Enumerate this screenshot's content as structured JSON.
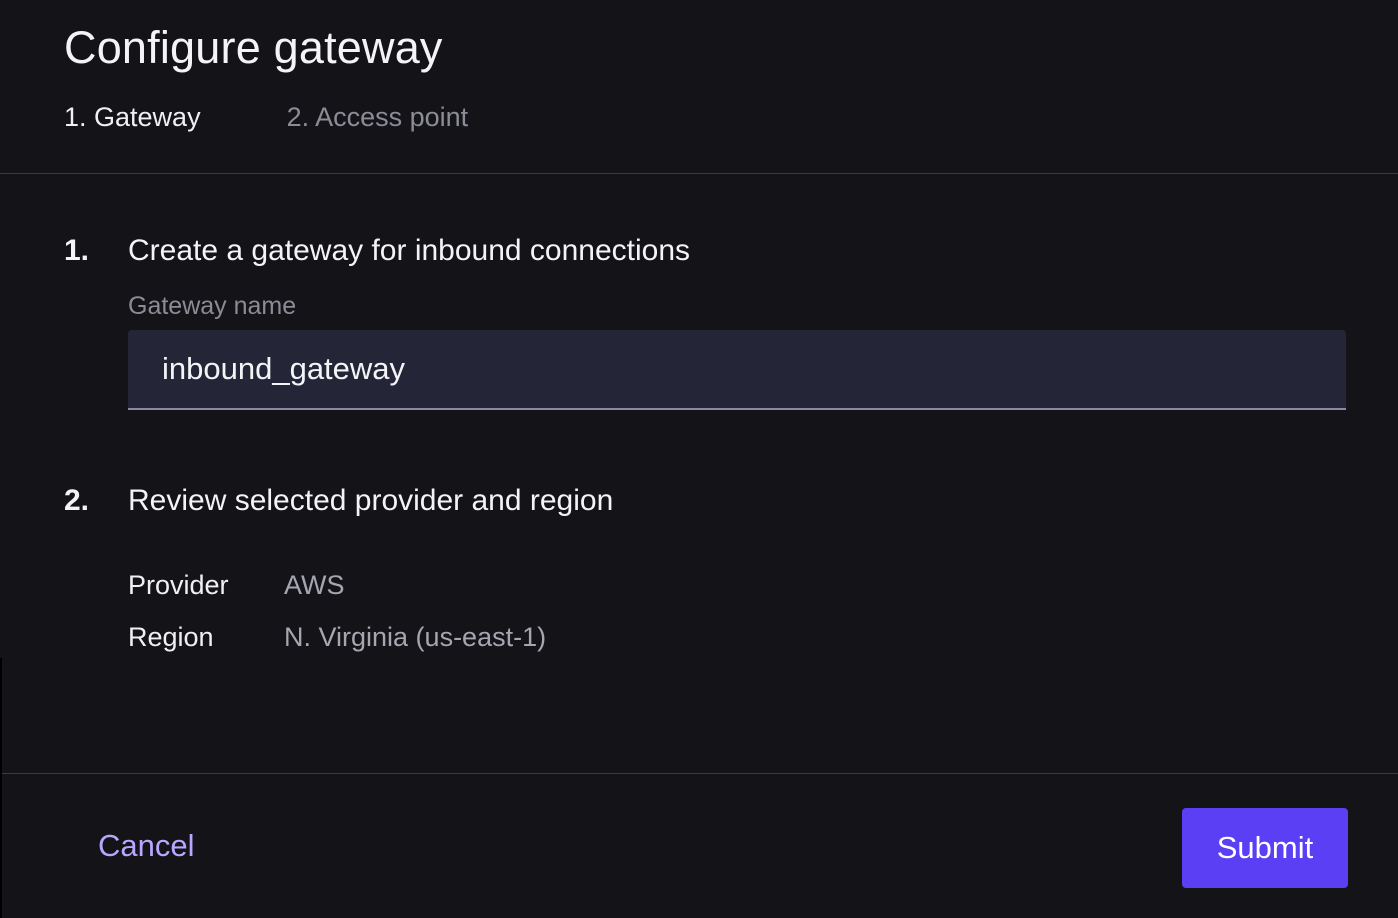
{
  "header": {
    "title": "Configure gateway",
    "steps": [
      {
        "label": "1. Gateway",
        "active": true
      },
      {
        "label": "2. Access point",
        "active": false
      }
    ]
  },
  "sections": [
    {
      "number": "1.",
      "title": "Create a gateway for inbound connections",
      "field_label": "Gateway name",
      "field_value": "inbound_gateway"
    },
    {
      "number": "2.",
      "title": "Review selected provider and region",
      "details": [
        {
          "key": "Provider",
          "value": "AWS"
        },
        {
          "key": "Region",
          "value": "N. Virginia (us-east-1)"
        }
      ]
    }
  ],
  "footer": {
    "cancel_label": "Cancel",
    "submit_label": "Submit"
  },
  "colors": {
    "background": "#131318",
    "input_background": "#242638",
    "accent": "#5b3ff5",
    "link": "#b8a6ff",
    "muted_text": "#8c8c96"
  }
}
